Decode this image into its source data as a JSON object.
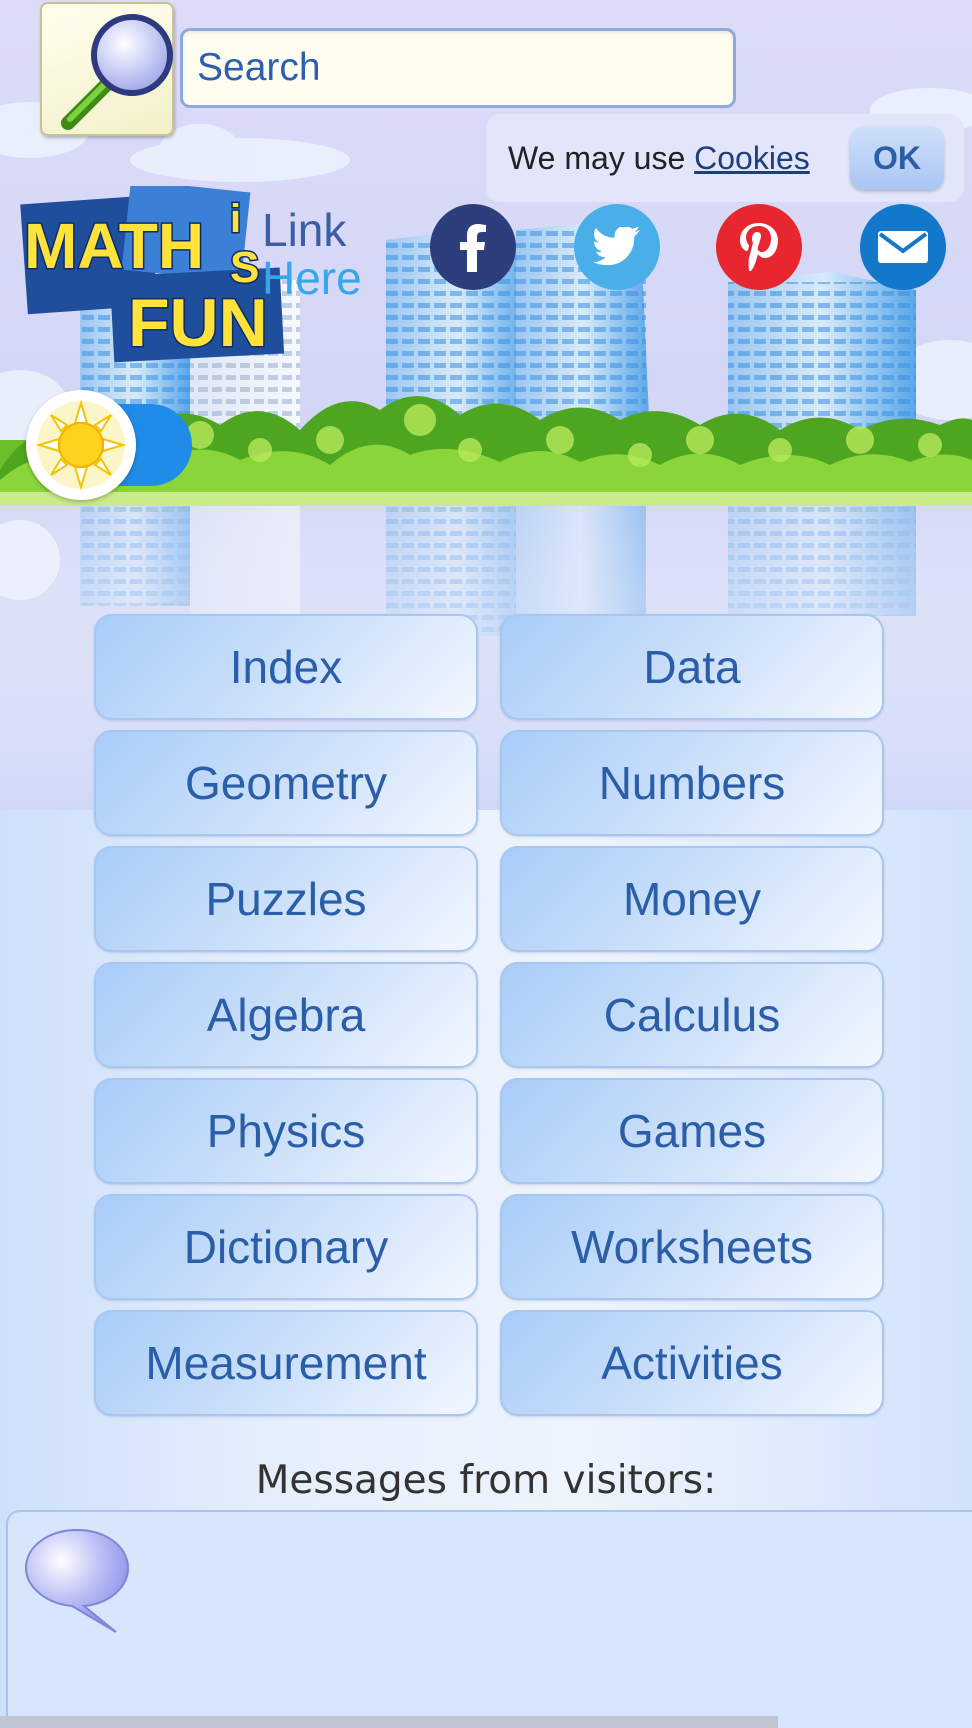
{
  "search": {
    "placeholder": "Search",
    "icon": "magnifier-icon"
  },
  "cookie_notice": {
    "text": "We may use",
    "link": "Cookies",
    "button": "OK"
  },
  "logo": {
    "text": "MATH IS FUN"
  },
  "header": {
    "link_here_line1": "Link",
    "link_here_line2": "Here"
  },
  "social": [
    {
      "name": "facebook",
      "color": "#2c3f7c"
    },
    {
      "name": "twitter",
      "color": "#4aaee8"
    },
    {
      "name": "pinterest",
      "color": "#e8262f"
    },
    {
      "name": "email",
      "color": "#1378c9"
    }
  ],
  "theme_toggle": {
    "icon": "sun-icon"
  },
  "nav": {
    "index": "Index",
    "data": "Data",
    "geometry": "Geometry",
    "numbers": "Numbers",
    "puzzles": "Puzzles",
    "money": "Money",
    "algebra": "Algebra",
    "calculus": "Calculus",
    "physics": "Physics",
    "games": "Games",
    "dictionary": "Dictionary",
    "worksheets": "Worksheets",
    "measurement": "Measurement",
    "activities": "Activities"
  },
  "messages": {
    "heading": "Messages from visitors:",
    "icon": "speech-bubble-icon"
  }
}
